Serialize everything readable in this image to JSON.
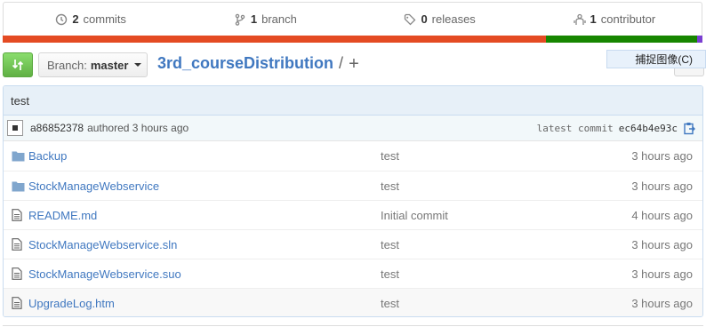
{
  "summary": {
    "commits": {
      "num": "2",
      "label": "commits",
      "icon": "history-icon"
    },
    "branches": {
      "num": "1",
      "label": "branch",
      "icon": "branch-icon"
    },
    "releases": {
      "num": "0",
      "label": "releases",
      "icon": "tag-icon"
    },
    "contributors": {
      "num": "1",
      "label": "contributor",
      "icon": "organization-icon"
    }
  },
  "language_bar": [
    {
      "color": "#e44b23",
      "share": 0.777
    },
    {
      "color": "#178600",
      "share": 0.216
    },
    {
      "color": "#7a3fd1",
      "share": 0.007
    }
  ],
  "toolbar": {
    "branch_label": "Branch:",
    "branch_value": "master",
    "repo_name": "3rd_courseDistribution",
    "separator": "/",
    "plus": "+"
  },
  "overlay": {
    "capture_tip": "捕捉图像(C)"
  },
  "commit": {
    "title": "test",
    "author": "a86852378",
    "authored": "authored 3 hours ago",
    "latest_label": "latest commit",
    "sha": "ec64b4e93c"
  },
  "files": [
    {
      "type": "folder",
      "name": "Backup",
      "message": "test",
      "age": "3 hours ago"
    },
    {
      "type": "folder",
      "name": "StockManageWebservice",
      "message": "test",
      "age": "3 hours ago"
    },
    {
      "type": "file",
      "name": "README.md",
      "message": "Initial commit",
      "age": "4 hours ago"
    },
    {
      "type": "file",
      "name": "StockManageWebservice.sln",
      "message": "test",
      "age": "3 hours ago"
    },
    {
      "type": "file",
      "name": "StockManageWebservice.suo",
      "message": "test",
      "age": "3 hours ago"
    },
    {
      "type": "file",
      "name": "UpgradeLog.htm",
      "message": "test",
      "age": "3 hours ago"
    }
  ],
  "colors": {
    "link": "#4078c0",
    "accent_green": "#60b044"
  }
}
